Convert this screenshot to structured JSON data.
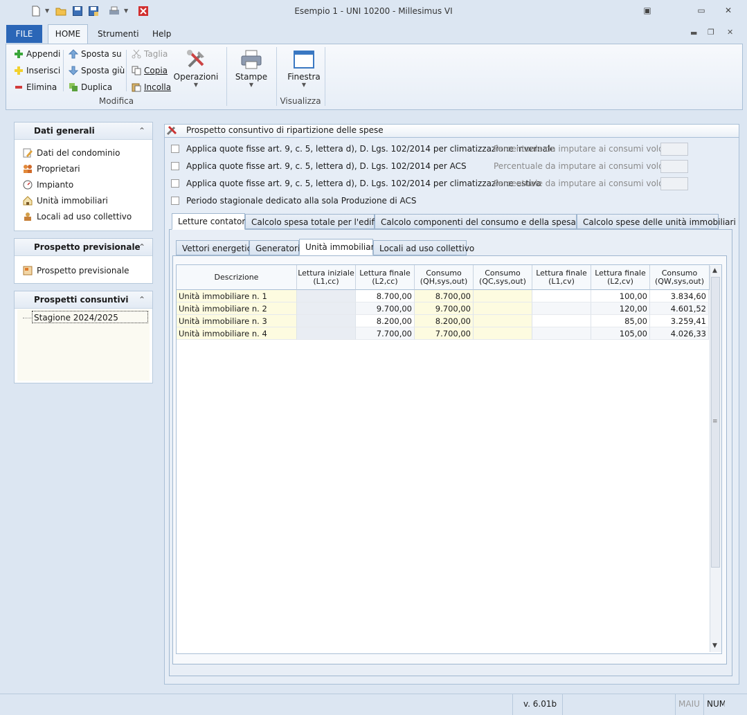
{
  "window": {
    "title": "Esempio 1 - UNI 10200 - Millesimus VI"
  },
  "menu": {
    "file": "FILE",
    "home": "HOME",
    "strumenti": "Strumenti",
    "help": "Help"
  },
  "ribbon": {
    "appendi": "Appendi",
    "inserisci": "Inserisci",
    "elimina": "Elimina",
    "sposta_su": "Sposta su",
    "sposta_giu": "Sposta giù",
    "duplica": "Duplica",
    "taglia": "Taglia",
    "copia": "Copia",
    "incolla": "Incolla",
    "operazioni": "Operazioni",
    "stampe": "Stampe",
    "finestra": "Finestra",
    "group_modifica": "Modifica",
    "group_visualizza": "Visualizza"
  },
  "left": {
    "dati_generali": {
      "title": "Dati generali",
      "items": [
        "Dati del condominio",
        "Proprietari",
        "Impianto",
        "Unità immobiliari",
        "Locali ad uso collettivo"
      ]
    },
    "previsionale": {
      "title": "Prospetto previsionale",
      "items": [
        "Prospetto previsionale"
      ]
    },
    "consuntivi": {
      "title": "Prospetti consuntivi",
      "items": [
        "Stagione 2024/2025"
      ]
    }
  },
  "main": {
    "title": "Prospetto consuntivo di ripartizione delle spese",
    "options": [
      "Applica quote fisse art. 9, c. 5, lettera d), D. Lgs. 102/2014 per climatizzazione invernale",
      "Applica quote fisse art. 9, c. 5, lettera d), D. Lgs. 102/2014 per ACS",
      "Applica quote fisse art. 9, c. 5, lettera d), D. Lgs. 102/2014 per climatizzazione estiva",
      "Periodo stagionale dedicato alla sola Produzione di ACS"
    ],
    "perc_label": "Percentuale da imputare ai consumi volontari:",
    "tabs": [
      "Letture contatori",
      "Calcolo spesa totale per l'edificio",
      "Calcolo componenti del consumo e della spesa totale",
      "Calcolo spese delle unità immobiliari"
    ],
    "subtabs": [
      "Vettori energetici",
      "Generatori",
      "Unità immobiliari",
      "Locali ad uso collettivo"
    ],
    "table": {
      "headers": [
        [
          "Descrizione",
          ""
        ],
        [
          "Lettura iniziale",
          "(L1,cc)"
        ],
        [
          "Lettura finale",
          "(L2,cc)"
        ],
        [
          "Consumo",
          "(QH,sys,out)"
        ],
        [
          "Consumo",
          "(QC,sys,out)"
        ],
        [
          "Lettura finale",
          "(L1,cv)"
        ],
        [
          "Lettura finale",
          "(L2,cv)"
        ],
        [
          "Consumo",
          "(QW,sys,out)"
        ]
      ],
      "rows": [
        [
          "Unità immobiliare n. 1",
          "",
          "8.700,00",
          "8.700,00",
          "",
          "",
          "100,00",
          "3.834,60"
        ],
        [
          "Unità immobiliare n. 2",
          "",
          "9.700,00",
          "9.700,00",
          "",
          "",
          "120,00",
          "4.601,52"
        ],
        [
          "Unità immobiliare n. 3",
          "",
          "8.200,00",
          "8.200,00",
          "",
          "",
          "85,00",
          "3.259,41"
        ],
        [
          "Unità immobiliare n. 4",
          "",
          "7.700,00",
          "7.700,00",
          "",
          "",
          "105,00",
          "4.026,33"
        ]
      ]
    }
  },
  "status": {
    "version": "v. 6.01b",
    "maiu": "MAIU",
    "num": "NUM"
  }
}
